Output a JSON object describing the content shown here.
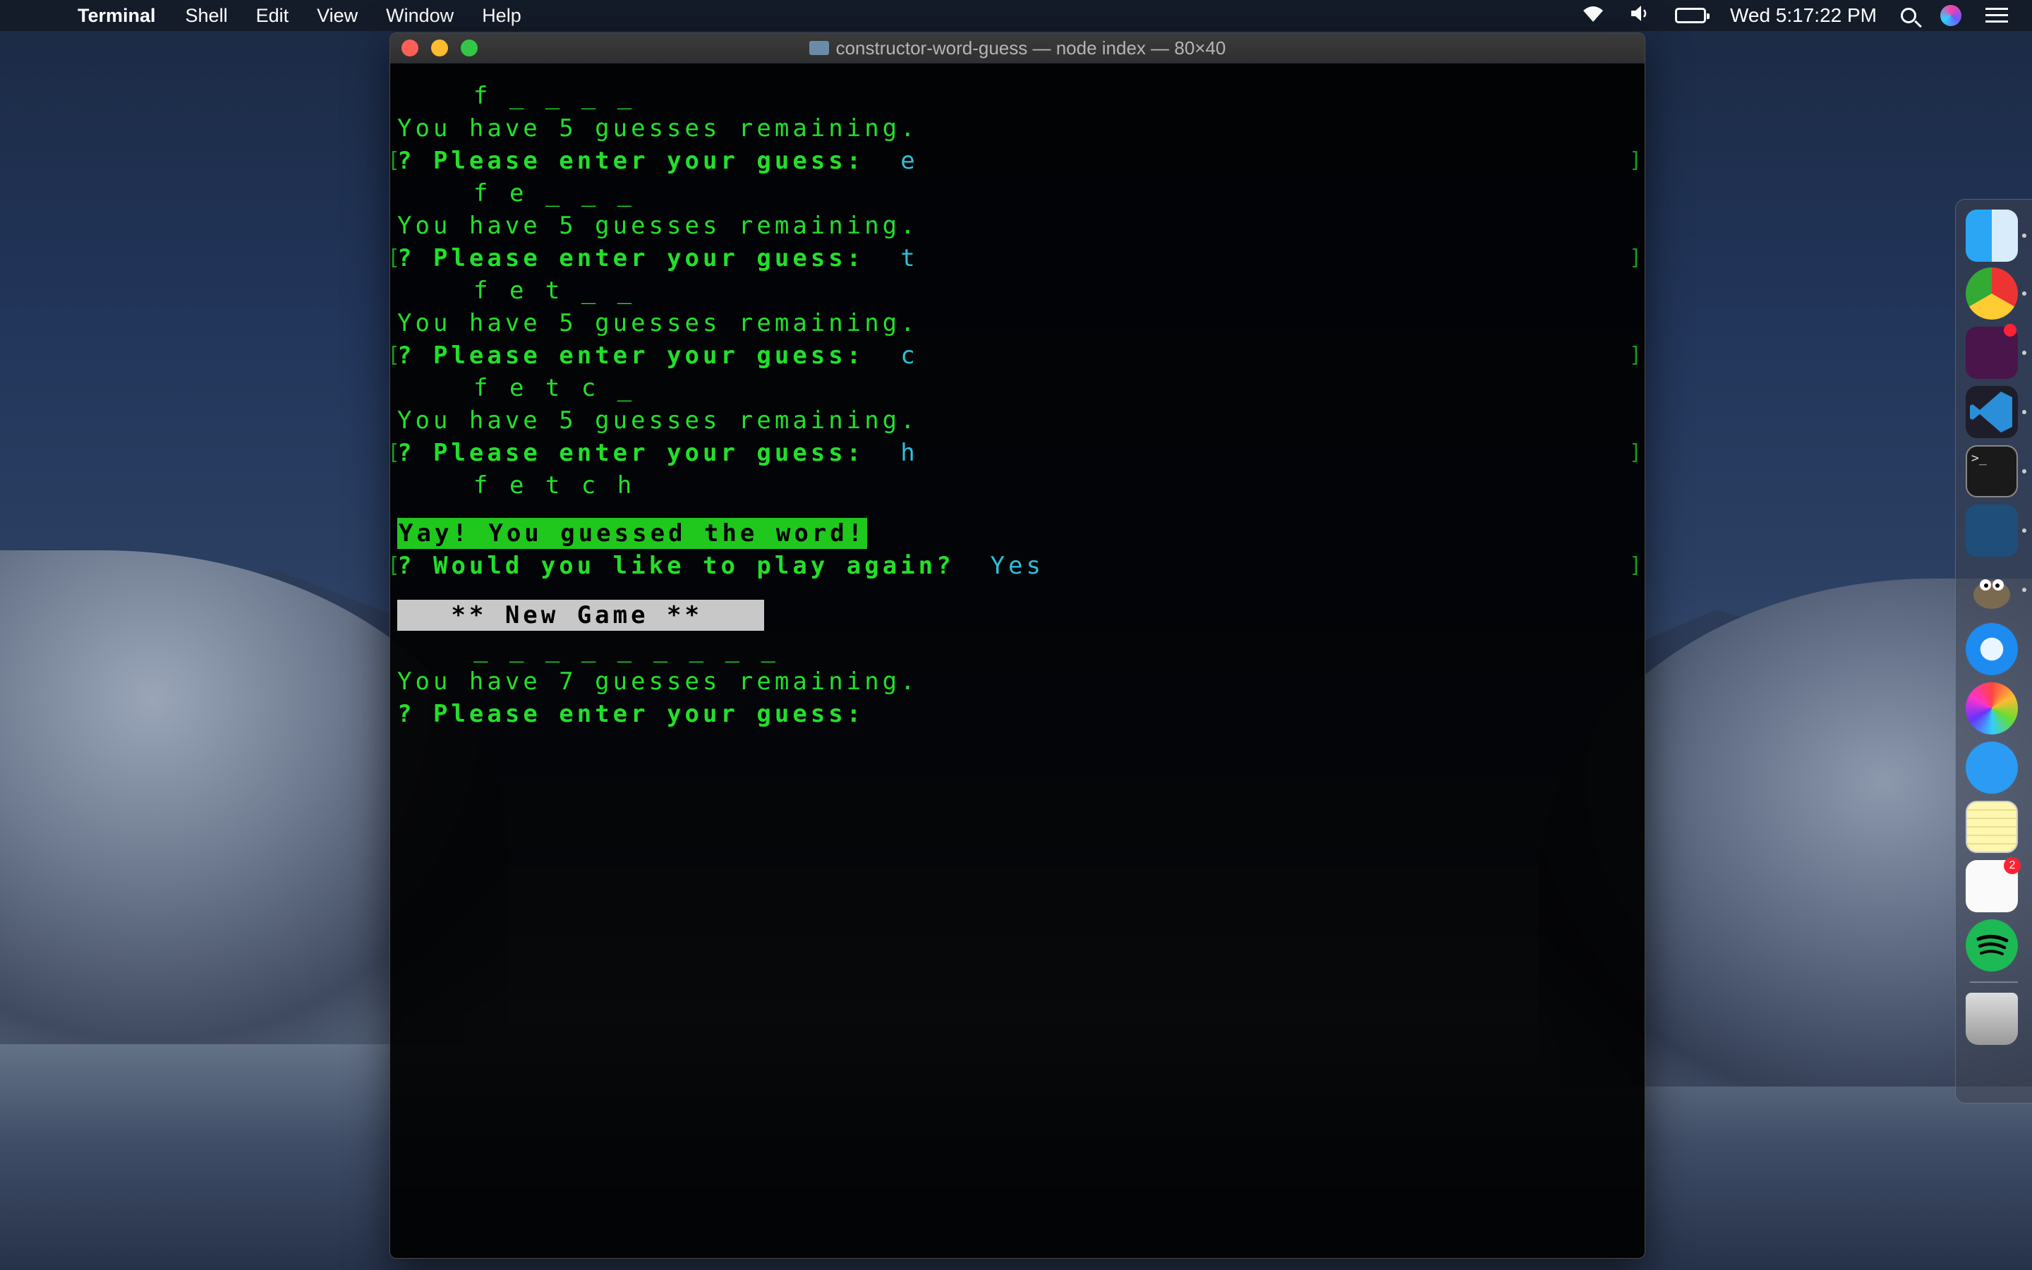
{
  "menubar": {
    "app_name": "Terminal",
    "items": [
      "Shell",
      "Edit",
      "View",
      "Window",
      "Help"
    ],
    "clock": "Wed 5:17:22 PM",
    "icons": [
      "wifi-icon",
      "volume-icon",
      "battery-icon",
      "spotlight-search-icon",
      "siri-icon",
      "notification-center-icon"
    ]
  },
  "window": {
    "title": "constructor-word-guess — node index — 80×40"
  },
  "terminal": {
    "word1": "f _ _ _ _",
    "remaining1": "You have 5 guesses remaining.",
    "prompt_label": "Please enter your guess:",
    "guess1": "e",
    "word2": "f e _ _ _",
    "remaining2": "You have 5 guesses remaining.",
    "guess2": "t",
    "word3": "f e t _ _",
    "remaining3": "You have 5 guesses remaining.",
    "guess3": "c",
    "word4": "f e t c _",
    "remaining4": "You have 5 guesses remaining.",
    "guess4": "h",
    "word5": "f e t c h",
    "success": "Yay! You guessed the word!",
    "play_again_label": "Would you like to play again?",
    "play_again_answer": "Yes",
    "new_game_banner": "** New Game **",
    "word6": "_ _ _ _ _ _ _ _ _",
    "remaining6": "You have 7 guesses remaining.",
    "qmark": "?",
    "bracket_right": "]",
    "bracket_left": "["
  },
  "dock": {
    "apps": [
      "Finder",
      "Google Chrome",
      "Slack",
      "Visual Studio Code",
      "Terminal",
      "MySQL Workbench",
      "GIMP",
      "Safari",
      "Photos",
      "Messages",
      "Notes",
      "Reminders",
      "Spotify",
      "Trash"
    ],
    "slack_badge": "",
    "reminders_badge": "2"
  }
}
